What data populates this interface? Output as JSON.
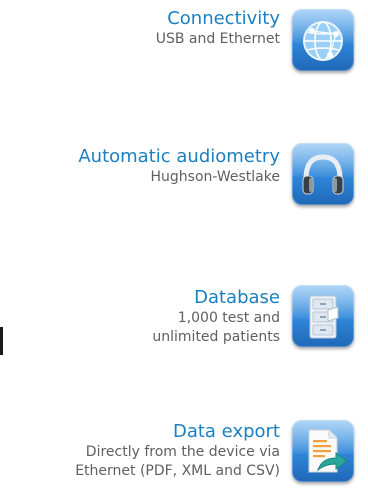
{
  "features": [
    {
      "title": "Connectivity",
      "description_lines": [
        "USB and Ethernet"
      ],
      "icon": "globe-network-icon"
    },
    {
      "title": "Automatic audiometry",
      "description_lines": [
        "Hughson-Westlake"
      ],
      "icon": "headphones-icon"
    },
    {
      "title": "Database",
      "description_lines": [
        "1,000 test and",
        "unlimited patients"
      ],
      "icon": "file-cabinet-icon"
    },
    {
      "title": "Data export",
      "description_lines": [
        "Directly from the device via",
        "Ethernet (PDF, XML and CSV)"
      ],
      "icon": "document-export-icon"
    }
  ],
  "colors": {
    "title": "#1a7fc1",
    "description": "#5f5f5f",
    "icon_background": "#2f86d8"
  }
}
